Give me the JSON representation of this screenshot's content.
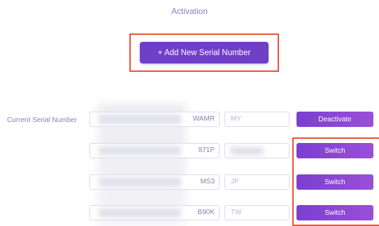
{
  "page": {
    "title": "Activation"
  },
  "actions": {
    "add_serial_label": "+ Add New Serial Number"
  },
  "serials": {
    "current_label": "Current Serial Number",
    "rows": [
      {
        "suffix": "WAMR",
        "country": "",
        "country_placeholder": "MY",
        "button": "Deactivate"
      },
      {
        "suffix": "871P",
        "country": "",
        "country_placeholder": "",
        "button": "Switch"
      },
      {
        "suffix": "MS3",
        "country": "",
        "country_placeholder": "JP",
        "button": "Switch"
      },
      {
        "suffix": "B90K",
        "country": "",
        "country_placeholder": "TW",
        "button": "Switch"
      }
    ]
  },
  "colors": {
    "primary": "#6f3fc7",
    "button_gradient_start": "#7b3fd0",
    "button_gradient_end": "#9a4fd8",
    "highlight": "#e8523a"
  }
}
